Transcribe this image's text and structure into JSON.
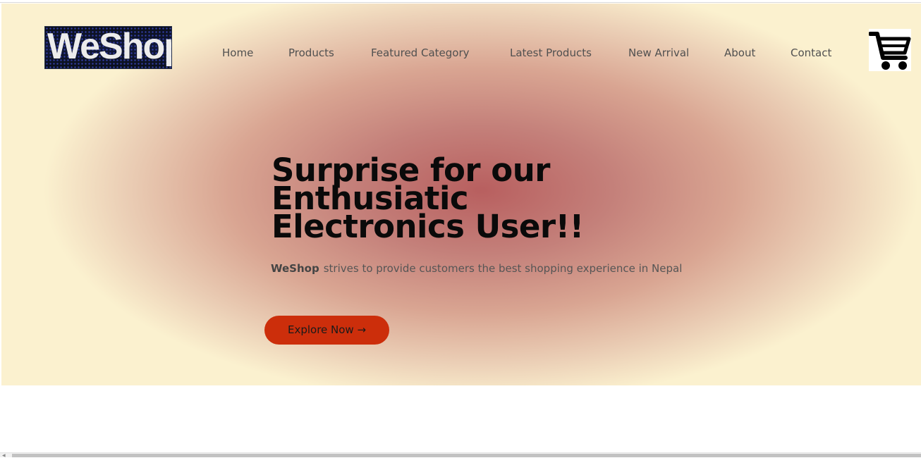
{
  "header": {
    "logo_text": "WeShop",
    "nav": [
      "Home",
      "Products",
      "Featured Category",
      "Latest Products",
      "New Arrival",
      "About",
      "Contact"
    ],
    "cart_icon": "shopping-cart-icon"
  },
  "hero": {
    "headline": "Surprise for our Enthusiatic Electronics User!!",
    "subtitle_brand": "WeShop",
    "subtitle_text": "strives to provide customers the best shopping experience in Nepal",
    "button_label": "Explore Now →"
  },
  "colors": {
    "accent": "#cc2e0b",
    "hero_center": "#b85f5f",
    "hero_edge": "#fbf1cf"
  }
}
